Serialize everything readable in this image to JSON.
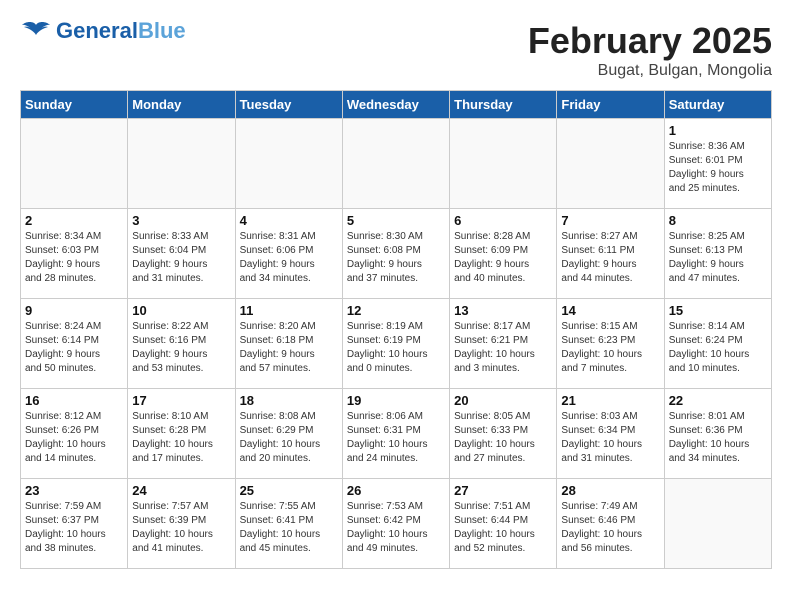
{
  "header": {
    "logo_general": "General",
    "logo_blue": "Blue",
    "title": "February 2025",
    "subtitle": "Bugat, Bulgan, Mongolia"
  },
  "weekdays": [
    "Sunday",
    "Monday",
    "Tuesday",
    "Wednesday",
    "Thursday",
    "Friday",
    "Saturday"
  ],
  "weeks": [
    [
      {
        "day": "",
        "info": ""
      },
      {
        "day": "",
        "info": ""
      },
      {
        "day": "",
        "info": ""
      },
      {
        "day": "",
        "info": ""
      },
      {
        "day": "",
        "info": ""
      },
      {
        "day": "",
        "info": ""
      },
      {
        "day": "1",
        "info": "Sunrise: 8:36 AM\nSunset: 6:01 PM\nDaylight: 9 hours\nand 25 minutes."
      }
    ],
    [
      {
        "day": "2",
        "info": "Sunrise: 8:34 AM\nSunset: 6:03 PM\nDaylight: 9 hours\nand 28 minutes."
      },
      {
        "day": "3",
        "info": "Sunrise: 8:33 AM\nSunset: 6:04 PM\nDaylight: 9 hours\nand 31 minutes."
      },
      {
        "day": "4",
        "info": "Sunrise: 8:31 AM\nSunset: 6:06 PM\nDaylight: 9 hours\nand 34 minutes."
      },
      {
        "day": "5",
        "info": "Sunrise: 8:30 AM\nSunset: 6:08 PM\nDaylight: 9 hours\nand 37 minutes."
      },
      {
        "day": "6",
        "info": "Sunrise: 8:28 AM\nSunset: 6:09 PM\nDaylight: 9 hours\nand 40 minutes."
      },
      {
        "day": "7",
        "info": "Sunrise: 8:27 AM\nSunset: 6:11 PM\nDaylight: 9 hours\nand 44 minutes."
      },
      {
        "day": "8",
        "info": "Sunrise: 8:25 AM\nSunset: 6:13 PM\nDaylight: 9 hours\nand 47 minutes."
      }
    ],
    [
      {
        "day": "9",
        "info": "Sunrise: 8:24 AM\nSunset: 6:14 PM\nDaylight: 9 hours\nand 50 minutes."
      },
      {
        "day": "10",
        "info": "Sunrise: 8:22 AM\nSunset: 6:16 PM\nDaylight: 9 hours\nand 53 minutes."
      },
      {
        "day": "11",
        "info": "Sunrise: 8:20 AM\nSunset: 6:18 PM\nDaylight: 9 hours\nand 57 minutes."
      },
      {
        "day": "12",
        "info": "Sunrise: 8:19 AM\nSunset: 6:19 PM\nDaylight: 10 hours\nand 0 minutes."
      },
      {
        "day": "13",
        "info": "Sunrise: 8:17 AM\nSunset: 6:21 PM\nDaylight: 10 hours\nand 3 minutes."
      },
      {
        "day": "14",
        "info": "Sunrise: 8:15 AM\nSunset: 6:23 PM\nDaylight: 10 hours\nand 7 minutes."
      },
      {
        "day": "15",
        "info": "Sunrise: 8:14 AM\nSunset: 6:24 PM\nDaylight: 10 hours\nand 10 minutes."
      }
    ],
    [
      {
        "day": "16",
        "info": "Sunrise: 8:12 AM\nSunset: 6:26 PM\nDaylight: 10 hours\nand 14 minutes."
      },
      {
        "day": "17",
        "info": "Sunrise: 8:10 AM\nSunset: 6:28 PM\nDaylight: 10 hours\nand 17 minutes."
      },
      {
        "day": "18",
        "info": "Sunrise: 8:08 AM\nSunset: 6:29 PM\nDaylight: 10 hours\nand 20 minutes."
      },
      {
        "day": "19",
        "info": "Sunrise: 8:06 AM\nSunset: 6:31 PM\nDaylight: 10 hours\nand 24 minutes."
      },
      {
        "day": "20",
        "info": "Sunrise: 8:05 AM\nSunset: 6:33 PM\nDaylight: 10 hours\nand 27 minutes."
      },
      {
        "day": "21",
        "info": "Sunrise: 8:03 AM\nSunset: 6:34 PM\nDaylight: 10 hours\nand 31 minutes."
      },
      {
        "day": "22",
        "info": "Sunrise: 8:01 AM\nSunset: 6:36 PM\nDaylight: 10 hours\nand 34 minutes."
      }
    ],
    [
      {
        "day": "23",
        "info": "Sunrise: 7:59 AM\nSunset: 6:37 PM\nDaylight: 10 hours\nand 38 minutes."
      },
      {
        "day": "24",
        "info": "Sunrise: 7:57 AM\nSunset: 6:39 PM\nDaylight: 10 hours\nand 41 minutes."
      },
      {
        "day": "25",
        "info": "Sunrise: 7:55 AM\nSunset: 6:41 PM\nDaylight: 10 hours\nand 45 minutes."
      },
      {
        "day": "26",
        "info": "Sunrise: 7:53 AM\nSunset: 6:42 PM\nDaylight: 10 hours\nand 49 minutes."
      },
      {
        "day": "27",
        "info": "Sunrise: 7:51 AM\nSunset: 6:44 PM\nDaylight: 10 hours\nand 52 minutes."
      },
      {
        "day": "28",
        "info": "Sunrise: 7:49 AM\nSunset: 6:46 PM\nDaylight: 10 hours\nand 56 minutes."
      },
      {
        "day": "",
        "info": ""
      }
    ]
  ]
}
